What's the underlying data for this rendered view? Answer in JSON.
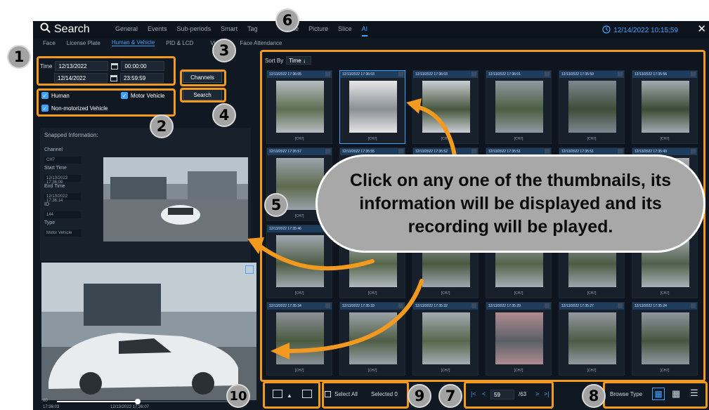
{
  "header": {
    "title": "Search",
    "tabs": [
      "General",
      "Events",
      "Sub-periods",
      "Smart",
      "Tag",
      "File",
      "Picture",
      "Slice",
      "AI"
    ],
    "active_tab": "AI",
    "datetime": "12/14/2022 10:15:59",
    "close_label": "✕"
  },
  "subtabs": {
    "items": [
      "Face",
      "License Plate",
      "Human & Vehicle",
      "PID & LCD",
      "Visitors",
      "Face Attendance"
    ],
    "active": "Human & Vehicle"
  },
  "filters": {
    "time_label": "Time",
    "start_date": "12/13/2022",
    "start_time": "00:00:00",
    "end_date": "12/14/2022",
    "end_time": "23:59:59",
    "human_label": "Human",
    "motor_label": "Motor Vehicle",
    "nonmotor_label": "Non-motorized Vehicle",
    "channels_label": "Channels",
    "search_label": "Search"
  },
  "snapped": {
    "heading": "Snapped Information:",
    "channel_label": "Channel",
    "channel": "CH7",
    "start_label": "Start Time",
    "start": "12/13/2022 17:36:09",
    "end_label": "End Time",
    "end": "12/13/2022 17:36:14",
    "id_label": "ID",
    "id": "144",
    "type_label": "Type",
    "type": "Motor Vehicle"
  },
  "player": {
    "time_start": "17:36:03",
    "time_current": "12/13/2022 17:36:07",
    "zoom_label": "00",
    "progress": 0.45
  },
  "grid": {
    "sort_label": "Sort By",
    "sort_value": "Time ↓",
    "thumbs": [
      {
        "ts": "12/13/2022 17:36:05",
        "ch": "[CH7]",
        "c1": "#5e6f52",
        "c2": "#b7bcc2"
      },
      {
        "ts": "12/13/2022 17:36:03",
        "ch": "[CH7]",
        "c1": "#8a8f95",
        "c2": "#e6e6e6"
      },
      {
        "ts": "12/13/2022 17:36:03",
        "ch": "[CH7]",
        "c1": "#47563d",
        "c2": "#c9ced3"
      },
      {
        "ts": "12/13/2022 17:36:01",
        "ch": "[CH7]",
        "c1": "#4c5e42",
        "c2": "#8f9aa3"
      },
      {
        "ts": "12/13/2022 17:35:59",
        "ch": "[CH7]",
        "c1": "#3f4c38",
        "c2": "#7d8891"
      },
      {
        "ts": "12/13/2022 17:35:56",
        "ch": "[CH7]",
        "c1": "#3c4b35",
        "c2": "#a2aab0"
      },
      {
        "ts": "12/13/2022 17:35:57",
        "ch": "[CH7]",
        "c1": "#5d6a4e",
        "c2": "#9aa3ab"
      },
      {
        "ts": "12/13/2022 17:35:55",
        "ch": "[CH7]",
        "c1": "#56654a",
        "c2": "#aab2b9"
      },
      {
        "ts": "12/13/2022 17:35:52",
        "ch": "[CH7]",
        "c1": "#4f5d44",
        "c2": "#9ba4ac"
      },
      {
        "ts": "12/13/2022 17:35:51",
        "ch": "[CH7]",
        "c1": "#4b5a41",
        "c2": "#8d979f"
      },
      {
        "ts": "12/13/2022 17:35:51",
        "ch": "[CH7]",
        "c1": "#46543c",
        "c2": "#98a1a9"
      },
      {
        "ts": "12/13/2022 17:35:49",
        "ch": "[CH7]",
        "c1": "#53624a",
        "c2": "#a7afb6"
      },
      {
        "ts": "12/13/2022 17:35:46",
        "ch": "[CH7]",
        "c1": "#4e5c45",
        "c2": "#a0a9b0"
      },
      {
        "ts": "",
        "ch": "[CH7]",
        "c1": "#56654b",
        "c2": "#b1b8be"
      },
      {
        "ts": "",
        "ch": "[CH7]",
        "c1": "#4a5841",
        "c2": "#9ea7ae"
      },
      {
        "ts": "",
        "ch": "[CH7]",
        "c1": "#55634b",
        "c2": "#a5adb4"
      },
      {
        "ts": "",
        "ch": "[CH7]",
        "c1": "#4d5b44",
        "c2": "#9da6ad"
      },
      {
        "ts": "",
        "ch": "[CH7]",
        "c1": "#50604a",
        "c2": "#a9b1b7"
      },
      {
        "ts": "12/13/2022 17:35:34",
        "ch": "[CH7]",
        "c1": "#4a5a40",
        "c2": "#8b9198"
      },
      {
        "ts": "12/13/2022 17:35:33",
        "ch": "[CH7]",
        "c1": "#505e46",
        "c2": "#9aa2a9"
      },
      {
        "ts": "12/13/2022 17:35:32",
        "ch": "[CH7]",
        "c1": "#58674c",
        "c2": "#a3abb2"
      },
      {
        "ts": "12/13/2022 17:35:29",
        "ch": "[CH7]",
        "c1": "#5a5f66",
        "c2": "#b08b92"
      },
      {
        "ts": "12/13/2022 17:35:27",
        "ch": "[CH7]",
        "c1": "#4c5a44",
        "c2": "#9299a0"
      },
      {
        "ts": "12/13/2022 17:35:24",
        "ch": "[CH7]",
        "c1": "#47553f",
        "c2": "#8e969d"
      }
    ]
  },
  "footer": {
    "select_all_label": "Select All",
    "selected_label": "Selected 0",
    "page": "59",
    "page_total": "/63",
    "browse_type_label": "Browse Type"
  },
  "annotation": {
    "callout": "Click on any one of the thumbnails, its information will be displayed and its recording will be played.",
    "badges": [
      "1",
      "2",
      "3",
      "4",
      "5",
      "6",
      "7",
      "8",
      "9",
      "10"
    ]
  },
  "colors": {
    "accent": "#3fa2ff",
    "highlight": "#f29a1f",
    "badge": "#a3a3a3",
    "background": "#101822"
  }
}
